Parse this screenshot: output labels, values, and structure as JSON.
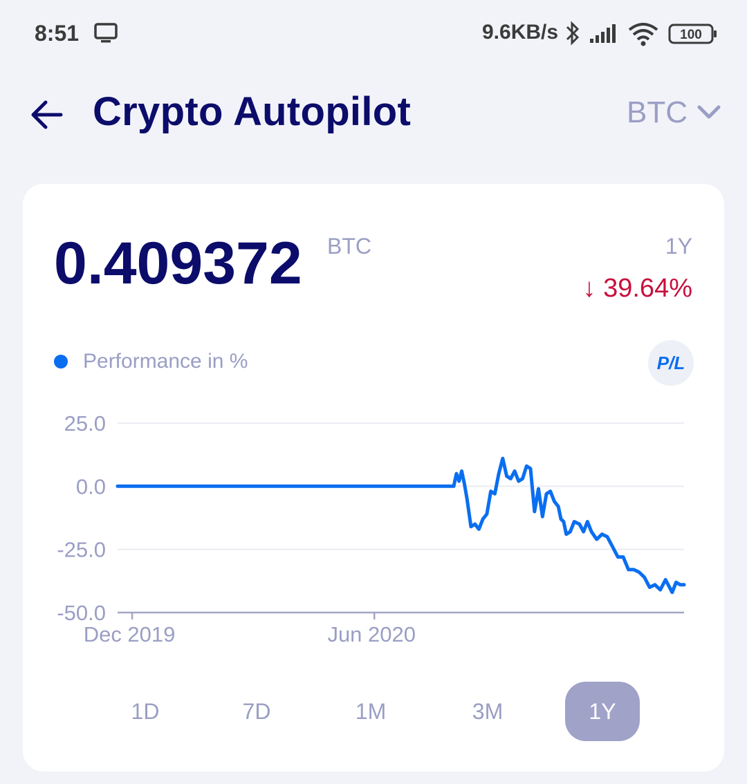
{
  "status_bar": {
    "time": "8:51",
    "network_speed": "9.6KB/s",
    "battery": "100",
    "icons": [
      "screen-cast-icon",
      "bluetooth-icon",
      "signal-icon",
      "wifi-icon",
      "battery-icon"
    ]
  },
  "header": {
    "title": "Crypto Autopilot",
    "currency": "BTC"
  },
  "card": {
    "balance": "0.409372",
    "balance_unit": "BTC",
    "period": "1Y",
    "change": "↓ 39.64%",
    "legend_label": "Performance in %",
    "pl_button": "P/L",
    "range_tabs": [
      "1D",
      "7D",
      "1M",
      "3M",
      "1Y"
    ],
    "active_tab": "1Y"
  },
  "colors": {
    "title": "#0c0c6b",
    "muted": "#9a9ec4",
    "line": "#0a6ef0",
    "negative": "#c8103d",
    "active_tab": "#a0a2c8"
  },
  "chart_data": {
    "type": "line",
    "ylim": [
      -50,
      25
    ],
    "yticks": [
      25.0,
      0.0,
      -25.0,
      -50.0
    ],
    "ytick_labels": [
      "25.0",
      "0.0",
      "-25.0",
      "-50.0"
    ],
    "xtick_labels": [
      "Dec 2019",
      "Jun 2020"
    ],
    "xtick_dates": [
      "2019-12-01",
      "2020-06-01"
    ],
    "grid": true,
    "series": [
      {
        "name": "Performance in %",
        "x": [
          "2019-11-20",
          "2020-01-01",
          "2020-02-01",
          "2020-03-01",
          "2020-04-01",
          "2020-05-01",
          "2020-06-01",
          "2020-07-01",
          "2020-07-31",
          "2020-08-02",
          "2020-08-04",
          "2020-08-06",
          "2020-08-08",
          "2020-08-10",
          "2020-08-13",
          "2020-08-16",
          "2020-08-19",
          "2020-08-22",
          "2020-08-25",
          "2020-08-28",
          "2020-08-31",
          "2020-09-03",
          "2020-09-06",
          "2020-09-09",
          "2020-09-12",
          "2020-09-15",
          "2020-09-18",
          "2020-09-21",
          "2020-09-24",
          "2020-09-27",
          "2020-09-30",
          "2020-10-03",
          "2020-10-06",
          "2020-10-09",
          "2020-10-12",
          "2020-10-15",
          "2020-10-18",
          "2020-10-20",
          "2020-10-22",
          "2020-10-24",
          "2020-10-27",
          "2020-10-30",
          "2020-11-03",
          "2020-11-06",
          "2020-11-09",
          "2020-11-12",
          "2020-11-16",
          "2020-11-20",
          "2020-11-24",
          "2020-11-28",
          "2020-12-02",
          "2020-12-06",
          "2020-12-10",
          "2020-12-14",
          "2020-12-18",
          "2020-12-22",
          "2020-12-26",
          "2020-12-30",
          "2021-01-03",
          "2021-01-07",
          "2021-01-10",
          "2021-01-12",
          "2021-01-15",
          "2021-01-18",
          "2021-01-21"
        ],
        "values": [
          0,
          0,
          0,
          0,
          0,
          0,
          0,
          0,
          0,
          5,
          2,
          6,
          1,
          -5,
          -16,
          -15,
          -17,
          -13,
          -11,
          -2,
          -3,
          5,
          11,
          4,
          3,
          6,
          2,
          3,
          8,
          7,
          -10,
          -1,
          -12,
          -3,
          -2,
          -6,
          -8,
          -13,
          -14,
          -19,
          -18,
          -14,
          -15,
          -18,
          -14,
          -18,
          -21,
          -19,
          -20,
          -24,
          -28,
          -28,
          -33,
          -33,
          -34,
          -36,
          -40,
          -39,
          -41,
          -37,
          -40,
          -42,
          -38,
          -39,
          -39
        ]
      }
    ]
  }
}
